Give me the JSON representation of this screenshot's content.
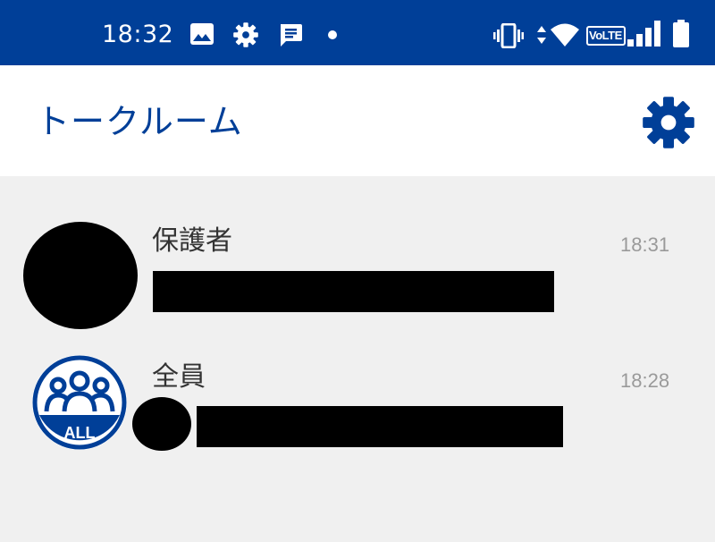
{
  "status_bar": {
    "time": "18:32",
    "left_icons": [
      "image-icon",
      "settings-icon",
      "message-icon",
      "dot-icon"
    ],
    "right_icons": [
      "vibrate-icon",
      "data-arrows-icon",
      "wifi-icon",
      "volte-icon",
      "signal-icon",
      "battery-icon"
    ],
    "volte_label": "VoLTE"
  },
  "app_bar": {
    "title": "トークルーム",
    "settings_icon": "gear-icon"
  },
  "colors": {
    "brand": "#003f98",
    "background": "#f0f0f0",
    "text_primary": "#333333",
    "text_secondary": "#9a9a9a"
  },
  "chat_rooms": [
    {
      "name": "保護者",
      "time": "18:31",
      "avatar": "redacted-avatar",
      "preview": "redacted"
    },
    {
      "name": "全員",
      "time": "18:28",
      "avatar": "all-group-icon",
      "avatar_label": "ALL",
      "preview": "redacted"
    }
  ]
}
